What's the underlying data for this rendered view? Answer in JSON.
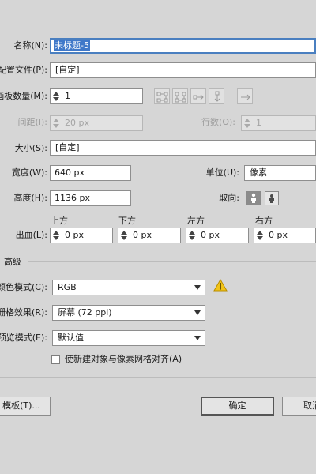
{
  "name": {
    "label": "名称(N):",
    "value": "未标题-5"
  },
  "profile": {
    "label": "配置文件(P):",
    "value": "[自定]"
  },
  "artboards": {
    "count_label": "画板数量(M):",
    "count_value": "1",
    "spacing_label": "间距(I):",
    "spacing_value": "20 px",
    "columns_label": "行数(O):",
    "columns_value": "1"
  },
  "size": {
    "label": "大小(S):",
    "value": "[自定]"
  },
  "width": {
    "label": "宽度(W):",
    "value": "640 px"
  },
  "height": {
    "label": "高度(H):",
    "value": "1136 px"
  },
  "units": {
    "label": "单位(U):",
    "value": "像素"
  },
  "orientation": {
    "label": "取向:"
  },
  "bleed": {
    "label": "出血(L):",
    "top_label": "上方",
    "top_value": "0 px",
    "bottom_label": "下方",
    "bottom_value": "0 px",
    "left_label": "左方",
    "left_value": "0 px",
    "right_label": "右方",
    "right_value": "0 px"
  },
  "advanced": {
    "title": "高级",
    "color_mode_label": "颜色模式(C):",
    "color_mode_value": "RGB",
    "raster_label": "栅格效果(R):",
    "raster_value": "屏幕 (72 ppi)",
    "preview_label": "预览模式(E):",
    "preview_value": "默认值",
    "align_pixel_label": "使新建对象与像素网格对齐(A)"
  },
  "buttons": {
    "templates": "模板(T)...",
    "ok": "确定",
    "cancel": "取消"
  }
}
